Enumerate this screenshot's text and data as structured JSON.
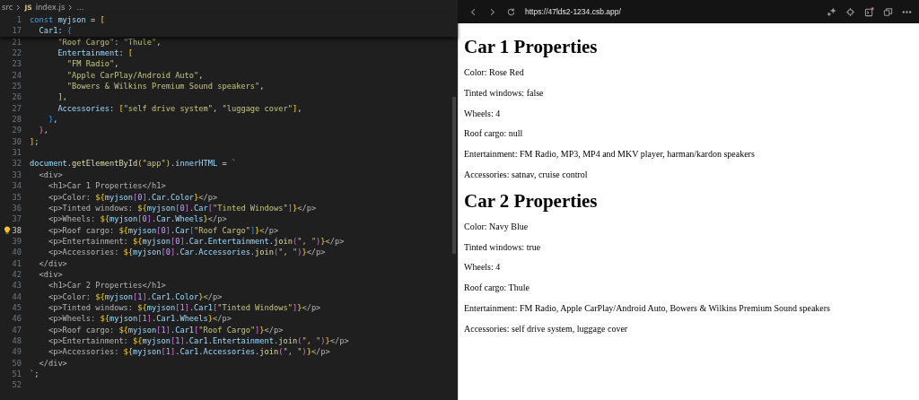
{
  "editor": {
    "breadcrumb": {
      "folder": "src",
      "file_badge": "JS",
      "file": "index.js",
      "more": "..."
    },
    "sticky_lines": [
      {
        "num": "1",
        "current": false,
        "tokens": [
          {
            "text": "const ",
            "kind": "kw"
          },
          {
            "text": "myjson",
            "kind": "var"
          },
          {
            "text": " = ",
            "kind": "p"
          },
          {
            "text": "[",
            "kind": "b1"
          }
        ]
      },
      {
        "num": "17",
        "current": false,
        "tokens": [
          {
            "text": "  Car1",
            "kind": "var"
          },
          {
            "text": ": ",
            "kind": "p"
          },
          {
            "text": "{",
            "kind": "b3"
          }
        ]
      }
    ],
    "lines": [
      {
        "num": "21",
        "current": false,
        "tokens": [
          {
            "text": "      \"Roof Cargo\"",
            "kind": "s"
          },
          {
            "text": ": ",
            "kind": "p"
          },
          {
            "text": "\"Thule\"",
            "kind": "s"
          },
          {
            "text": ",",
            "kind": "p"
          }
        ]
      },
      {
        "num": "22",
        "current": false,
        "tokens": [
          {
            "text": "      Entertainment",
            "kind": "var"
          },
          {
            "text": ": ",
            "kind": "p"
          },
          {
            "text": "[",
            "kind": "b1"
          }
        ]
      },
      {
        "num": "23",
        "current": false,
        "tokens": [
          {
            "text": "        \"FM Radio\"",
            "kind": "s"
          },
          {
            "text": ",",
            "kind": "p"
          }
        ]
      },
      {
        "num": "24",
        "current": false,
        "tokens": [
          {
            "text": "        \"Apple CarPlay/Android Auto\"",
            "kind": "s"
          },
          {
            "text": ",",
            "kind": "p"
          }
        ]
      },
      {
        "num": "25",
        "current": false,
        "tokens": [
          {
            "text": "        \"Bowers & Wilkins Premium Sound speakers\"",
            "kind": "s"
          },
          {
            "text": ",",
            "kind": "p"
          }
        ]
      },
      {
        "num": "26",
        "current": false,
        "tokens": [
          {
            "text": "      ]",
            "kind": "b1"
          },
          {
            "text": ",",
            "kind": "p"
          }
        ]
      },
      {
        "num": "27",
        "current": false,
        "tokens": [
          {
            "text": "      Accessories",
            "kind": "var"
          },
          {
            "text": ": ",
            "kind": "p"
          },
          {
            "text": "[",
            "kind": "b1"
          },
          {
            "text": "\"self drive system\"",
            "kind": "s"
          },
          {
            "text": ", ",
            "kind": "p"
          },
          {
            "text": "\"luggage cover\"",
            "kind": "s"
          },
          {
            "text": "]",
            "kind": "b1"
          },
          {
            "text": ",",
            "kind": "p"
          }
        ]
      },
      {
        "num": "28",
        "current": false,
        "tokens": [
          {
            "text": "    }",
            "kind": "b3"
          },
          {
            "text": ",",
            "kind": "p"
          }
        ]
      },
      {
        "num": "29",
        "current": false,
        "tokens": [
          {
            "text": "  }",
            "kind": "b2"
          },
          {
            "text": ",",
            "kind": "p"
          }
        ]
      },
      {
        "num": "30",
        "current": false,
        "tokens": [
          {
            "text": "]",
            "kind": "b1"
          },
          {
            "text": ";",
            "kind": "p"
          }
        ]
      },
      {
        "num": "31",
        "current": false
      },
      {
        "num": "32",
        "current": false,
        "tokens": [
          {
            "text": "document",
            "kind": "var"
          },
          {
            "text": ".",
            "kind": "p"
          },
          {
            "text": "getElementById",
            "kind": "fn"
          },
          {
            "text": "(",
            "kind": "b1"
          },
          {
            "text": "\"app\"",
            "kind": "s"
          },
          {
            "text": ")",
            "kind": "b1"
          },
          {
            "text": ".",
            "kind": "p"
          },
          {
            "text": "innerHTML",
            "kind": "var"
          },
          {
            "text": " = ",
            "kind": "p"
          },
          {
            "text": "`",
            "kind": "s"
          }
        ]
      },
      {
        "num": "33",
        "current": false,
        "tokens": [
          {
            "text": "  <div>",
            "kind": "t"
          }
        ]
      },
      {
        "num": "34",
        "current": false,
        "tokens": [
          {
            "text": "    <h1>Car 1 Properties</h1>",
            "kind": "t"
          }
        ]
      },
      {
        "num": "35",
        "current": false,
        "tokens": [
          {
            "text": "    <p>Color: ",
            "kind": "t"
          },
          {
            "text": "${",
            "kind": "b1"
          },
          {
            "text": "myjson",
            "kind": "var"
          },
          {
            "text": "[",
            "kind": "b2"
          },
          {
            "text": "0",
            "kind": "n"
          },
          {
            "text": "]",
            "kind": "b2"
          },
          {
            "text": ".Car.Color",
            "kind": "var"
          },
          {
            "text": "}",
            "kind": "b1"
          },
          {
            "text": "</p>",
            "kind": "t"
          }
        ]
      },
      {
        "num": "36",
        "current": false,
        "tokens": [
          {
            "text": "    <p>Tinted windows: ",
            "kind": "t"
          },
          {
            "text": "${",
            "kind": "b1"
          },
          {
            "text": "myjson",
            "kind": "var"
          },
          {
            "text": "[",
            "kind": "b2"
          },
          {
            "text": "0",
            "kind": "n"
          },
          {
            "text": "]",
            "kind": "b2"
          },
          {
            "text": ".Car",
            "kind": "var"
          },
          {
            "text": "[",
            "kind": "b2"
          },
          {
            "text": "\"Tinted Windows\"",
            "kind": "s"
          },
          {
            "text": "]",
            "kind": "b2"
          },
          {
            "text": "}",
            "kind": "b1"
          },
          {
            "text": "</p>",
            "kind": "t"
          }
        ]
      },
      {
        "num": "37",
        "current": false,
        "tokens": [
          {
            "text": "    <p>Wheels: ",
            "kind": "t"
          },
          {
            "text": "${",
            "kind": "b1"
          },
          {
            "text": "myjson",
            "kind": "var"
          },
          {
            "text": "[",
            "kind": "b2"
          },
          {
            "text": "0",
            "kind": "n"
          },
          {
            "text": "]",
            "kind": "b2"
          },
          {
            "text": ".Car.Wheels",
            "kind": "var"
          },
          {
            "text": "}",
            "kind": "b1"
          },
          {
            "text": "</p>",
            "kind": "t"
          }
        ]
      },
      {
        "num": "38",
        "current": true,
        "tokens": [
          {
            "text": "    <p>Roof cargo: ",
            "kind": "t"
          },
          {
            "text": "${",
            "kind": "b1"
          },
          {
            "text": "myjson",
            "kind": "var"
          },
          {
            "text": "[",
            "kind": "b2"
          },
          {
            "text": "0",
            "kind": "n"
          },
          {
            "text": "]",
            "kind": "b2"
          },
          {
            "text": ".Car",
            "kind": "var"
          },
          {
            "text": "[",
            "kind": "b3"
          },
          {
            "text": "\"Roof Cargo\"",
            "kind": "s"
          },
          {
            "text": "]",
            "kind": "b3"
          },
          {
            "text": "}",
            "kind": "b1"
          },
          {
            "text": "</p>",
            "kind": "t"
          }
        ]
      },
      {
        "num": "39",
        "current": false,
        "tokens": [
          {
            "text": "    <p>Entertainment: ",
            "kind": "t"
          },
          {
            "text": "${",
            "kind": "b1"
          },
          {
            "text": "myjson",
            "kind": "var"
          },
          {
            "text": "[",
            "kind": "b2"
          },
          {
            "text": "0",
            "kind": "n"
          },
          {
            "text": "]",
            "kind": "b2"
          },
          {
            "text": ".Car.Entertainment.",
            "kind": "var"
          },
          {
            "text": "join",
            "kind": "fn"
          },
          {
            "text": "(",
            "kind": "b2"
          },
          {
            "text": "\", \"",
            "kind": "s"
          },
          {
            "text": ")",
            "kind": "b2"
          },
          {
            "text": "}",
            "kind": "b1"
          },
          {
            "text": "</p>",
            "kind": "t"
          }
        ]
      },
      {
        "num": "40",
        "current": false,
        "tokens": [
          {
            "text": "    <p>Accessories: ",
            "kind": "t"
          },
          {
            "text": "${",
            "kind": "b1"
          },
          {
            "text": "myjson",
            "kind": "var"
          },
          {
            "text": "[",
            "kind": "b2"
          },
          {
            "text": "0",
            "kind": "n"
          },
          {
            "text": "]",
            "kind": "b2"
          },
          {
            "text": ".Car.Accessories.",
            "kind": "var"
          },
          {
            "text": "join",
            "kind": "fn"
          },
          {
            "text": "(",
            "kind": "b2"
          },
          {
            "text": "\", \"",
            "kind": "s"
          },
          {
            "text": ")",
            "kind": "b2"
          },
          {
            "text": "}",
            "kind": "b1"
          },
          {
            "text": "</p>",
            "kind": "t"
          }
        ]
      },
      {
        "num": "41",
        "current": false,
        "tokens": [
          {
            "text": "  </div>",
            "kind": "t"
          }
        ]
      },
      {
        "num": "42",
        "current": false,
        "tokens": [
          {
            "text": "  <div>",
            "kind": "t"
          }
        ]
      },
      {
        "num": "43",
        "current": false,
        "tokens": [
          {
            "text": "    <h1>Car 2 Properties</h1>",
            "kind": "t"
          }
        ]
      },
      {
        "num": "44",
        "current": false,
        "tokens": [
          {
            "text": "    <p>Color: ",
            "kind": "t"
          },
          {
            "text": "${",
            "kind": "b1"
          },
          {
            "text": "myjson",
            "kind": "var"
          },
          {
            "text": "[",
            "kind": "b2"
          },
          {
            "text": "1",
            "kind": "n"
          },
          {
            "text": "]",
            "kind": "b2"
          },
          {
            "text": ".Car1.Color",
            "kind": "var"
          },
          {
            "text": "}",
            "kind": "b1"
          },
          {
            "text": "</p>",
            "kind": "t"
          }
        ]
      },
      {
        "num": "45",
        "current": false,
        "tokens": [
          {
            "text": "    <p>Tinted windows: ",
            "kind": "t"
          },
          {
            "text": "${",
            "kind": "b1"
          },
          {
            "text": "myjson",
            "kind": "var"
          },
          {
            "text": "[",
            "kind": "b2"
          },
          {
            "text": "1",
            "kind": "n"
          },
          {
            "text": "]",
            "kind": "b2"
          },
          {
            "text": ".Car1",
            "kind": "var"
          },
          {
            "text": "[",
            "kind": "b2"
          },
          {
            "text": "\"Tinted Windows\"",
            "kind": "s"
          },
          {
            "text": "]",
            "kind": "b2"
          },
          {
            "text": "}",
            "kind": "b1"
          },
          {
            "text": "</p>",
            "kind": "t"
          }
        ]
      },
      {
        "num": "46",
        "current": false,
        "tokens": [
          {
            "text": "    <p>Wheels: ",
            "kind": "t"
          },
          {
            "text": "${",
            "kind": "b1"
          },
          {
            "text": "myjson",
            "kind": "var"
          },
          {
            "text": "[",
            "kind": "b2"
          },
          {
            "text": "1",
            "kind": "n"
          },
          {
            "text": "]",
            "kind": "b2"
          },
          {
            "text": ".Car1.Wheels",
            "kind": "var"
          },
          {
            "text": "}",
            "kind": "b1"
          },
          {
            "text": "</p>",
            "kind": "t"
          }
        ]
      },
      {
        "num": "47",
        "current": false,
        "tokens": [
          {
            "text": "    <p>Roof cargo: ",
            "kind": "t"
          },
          {
            "text": "${",
            "kind": "b1"
          },
          {
            "text": "myjson",
            "kind": "var"
          },
          {
            "text": "[",
            "kind": "b2"
          },
          {
            "text": "1",
            "kind": "n"
          },
          {
            "text": "]",
            "kind": "b2"
          },
          {
            "text": ".Car1",
            "kind": "var"
          },
          {
            "text": "[",
            "kind": "b2"
          },
          {
            "text": "\"Roof Cargo\"",
            "kind": "s"
          },
          {
            "text": "]",
            "kind": "b2"
          },
          {
            "text": "}",
            "kind": "b1"
          },
          {
            "text": "</p>",
            "kind": "t"
          }
        ]
      },
      {
        "num": "48",
        "current": false,
        "tokens": [
          {
            "text": "    <p>Entertainment: ",
            "kind": "t"
          },
          {
            "text": "${",
            "kind": "b1"
          },
          {
            "text": "myjson",
            "kind": "var"
          },
          {
            "text": "[",
            "kind": "b2"
          },
          {
            "text": "1",
            "kind": "n"
          },
          {
            "text": "]",
            "kind": "b2"
          },
          {
            "text": ".Car1.Entertainment.",
            "kind": "var"
          },
          {
            "text": "join",
            "kind": "fn"
          },
          {
            "text": "(",
            "kind": "b2"
          },
          {
            "text": "\", \"",
            "kind": "s"
          },
          {
            "text": ")",
            "kind": "b2"
          },
          {
            "text": "}",
            "kind": "b1"
          },
          {
            "text": "</p>",
            "kind": "t"
          }
        ]
      },
      {
        "num": "49",
        "current": false,
        "tokens": [
          {
            "text": "    <p>Accessories: ",
            "kind": "t"
          },
          {
            "text": "${",
            "kind": "b1"
          },
          {
            "text": "myjson",
            "kind": "var"
          },
          {
            "text": "[",
            "kind": "b2"
          },
          {
            "text": "1",
            "kind": "n"
          },
          {
            "text": "]",
            "kind": "b2"
          },
          {
            "text": ".Car1.Accessories.",
            "kind": "var"
          },
          {
            "text": "join",
            "kind": "fn"
          },
          {
            "text": "(",
            "kind": "b2"
          },
          {
            "text": "\", \"",
            "kind": "s"
          },
          {
            "text": ")",
            "kind": "b2"
          },
          {
            "text": "}",
            "kind": "b1"
          },
          {
            "text": "</p>",
            "kind": "t"
          }
        ]
      },
      {
        "num": "50",
        "current": false,
        "tokens": [
          {
            "text": "  </div>",
            "kind": "t"
          }
        ]
      },
      {
        "num": "51",
        "current": false,
        "tokens": [
          {
            "text": "`",
            "kind": "s"
          },
          {
            "text": ";",
            "kind": "p"
          }
        ]
      },
      {
        "num": "52",
        "current": false
      }
    ]
  },
  "browser": {
    "url": "https://47lds2-1234.csb.app/",
    "sections": [
      {
        "heading": "Car 1 Properties",
        "lines": [
          "Color: Rose Red",
          "Tinted windows: false",
          "Wheels: 4",
          "Roof cargo: null",
          "Entertainment: FM Radio, MP3, MP4 and MKV player, harman/kardon speakers",
          "Accessories: satnav, cruise control"
        ]
      },
      {
        "heading": "Car 2 Properties",
        "lines": [
          "Color: Navy Blue",
          "Tinted windows: true",
          "Wheels: 4",
          "Roof cargo: Thule",
          "Entertainment: FM Radio, Apple CarPlay/Android Auto, Bowers & Wilkins Premium Sound speakers",
          "Accessories: self drive system, luggage cover"
        ]
      }
    ]
  }
}
